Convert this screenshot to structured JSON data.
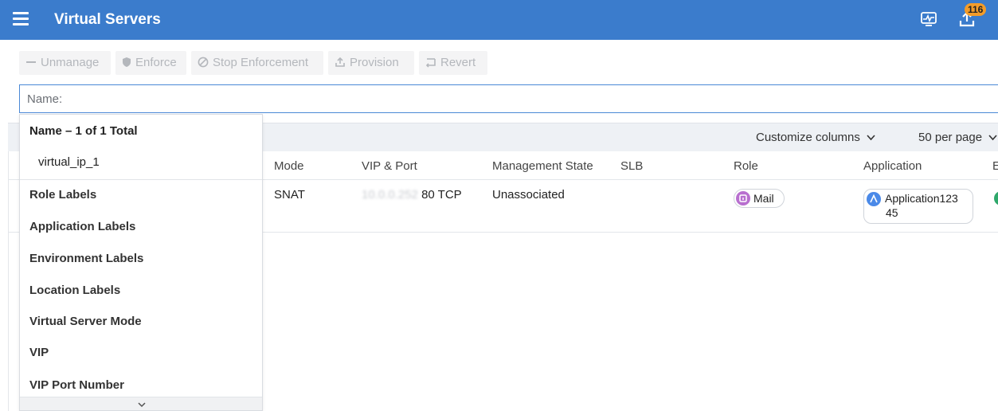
{
  "header": {
    "title": "Virtual Servers",
    "notification_count": "116",
    "icons": [
      "menu-icon",
      "monitor-icon",
      "upload-icon"
    ]
  },
  "toolbar": {
    "unmanage": "Unmanage",
    "enforce": "Enforce",
    "stop_enforcement": "Stop Enforcement",
    "provision": "Provision",
    "revert": "Revert"
  },
  "search": {
    "placeholder": "Name:"
  },
  "dropdown": {
    "heading": "Name – 1 of 1 Total",
    "result": "virtual_ip_1",
    "categories": [
      "Role Labels",
      "Application Labels",
      "Environment Labels",
      "Location Labels",
      "Virtual Server Mode",
      "VIP",
      "VIP Port Number"
    ]
  },
  "table": {
    "customize_columns": "Customize columns",
    "per_page": "50 per page",
    "columns": [
      "Mode",
      "VIP & Port",
      "Management State",
      "SLB",
      "Role",
      "Application",
      "E"
    ],
    "rows": [
      {
        "mode": "SNAT",
        "vip_ip": "10.0.0.252",
        "vip_port": "80 TCP",
        "management_state": "Unassociated",
        "slb": "",
        "role": "Mail",
        "application_line1": "Application123",
        "application_line2": "45"
      }
    ]
  },
  "colors": {
    "header_bg": "#3b7ccc",
    "badge": "#f39c2a",
    "role_icon": "#b86fcf",
    "app_icon": "#4a89e8",
    "env_icon": "#2fa86b"
  }
}
